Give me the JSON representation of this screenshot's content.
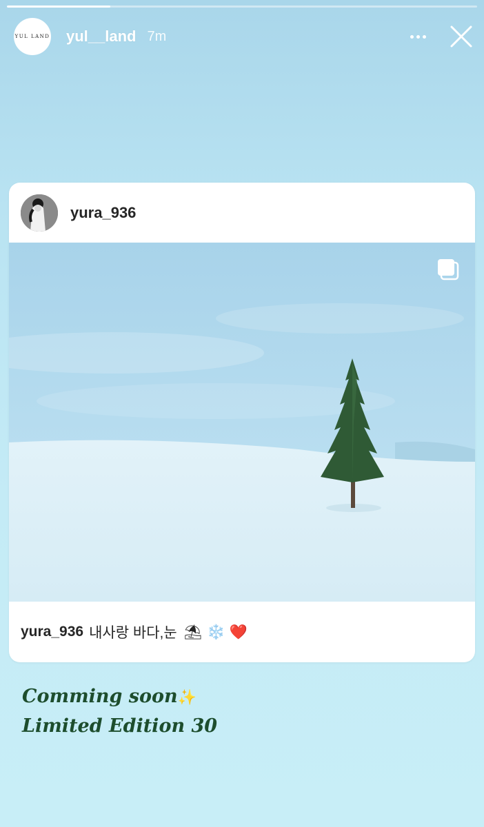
{
  "story": {
    "progress": 0.22,
    "avatar_text": "YUL LAND",
    "username": "yul__land",
    "time": "7m"
  },
  "post": {
    "username": "yura_936",
    "caption_user": "yura_936",
    "caption_text": "내사랑 바다,눈",
    "caption_emoji": "⛱ ❄️ ❤️"
  },
  "overlay": {
    "line1": "Comming soon",
    "line1_emoji": "✨",
    "line2": "Limited Edition 30"
  }
}
